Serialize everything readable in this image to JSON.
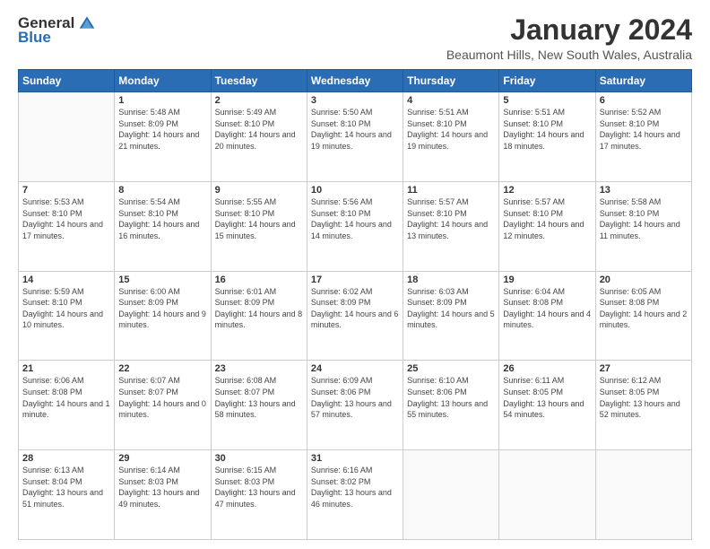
{
  "logo": {
    "general": "General",
    "blue": "Blue"
  },
  "title": "January 2024",
  "location": "Beaumont Hills, New South Wales, Australia",
  "days_header": [
    "Sunday",
    "Monday",
    "Tuesday",
    "Wednesday",
    "Thursday",
    "Friday",
    "Saturday"
  ],
  "weeks": [
    [
      {
        "day": "",
        "sunrise": "",
        "sunset": "",
        "daylight": ""
      },
      {
        "day": "1",
        "sunrise": "Sunrise: 5:48 AM",
        "sunset": "Sunset: 8:09 PM",
        "daylight": "Daylight: 14 hours and 21 minutes."
      },
      {
        "day": "2",
        "sunrise": "Sunrise: 5:49 AM",
        "sunset": "Sunset: 8:10 PM",
        "daylight": "Daylight: 14 hours and 20 minutes."
      },
      {
        "day": "3",
        "sunrise": "Sunrise: 5:50 AM",
        "sunset": "Sunset: 8:10 PM",
        "daylight": "Daylight: 14 hours and 19 minutes."
      },
      {
        "day": "4",
        "sunrise": "Sunrise: 5:51 AM",
        "sunset": "Sunset: 8:10 PM",
        "daylight": "Daylight: 14 hours and 19 minutes."
      },
      {
        "day": "5",
        "sunrise": "Sunrise: 5:51 AM",
        "sunset": "Sunset: 8:10 PM",
        "daylight": "Daylight: 14 hours and 18 minutes."
      },
      {
        "day": "6",
        "sunrise": "Sunrise: 5:52 AM",
        "sunset": "Sunset: 8:10 PM",
        "daylight": "Daylight: 14 hours and 17 minutes."
      }
    ],
    [
      {
        "day": "7",
        "sunrise": "Sunrise: 5:53 AM",
        "sunset": "Sunset: 8:10 PM",
        "daylight": "Daylight: 14 hours and 17 minutes."
      },
      {
        "day": "8",
        "sunrise": "Sunrise: 5:54 AM",
        "sunset": "Sunset: 8:10 PM",
        "daylight": "Daylight: 14 hours and 16 minutes."
      },
      {
        "day": "9",
        "sunrise": "Sunrise: 5:55 AM",
        "sunset": "Sunset: 8:10 PM",
        "daylight": "Daylight: 14 hours and 15 minutes."
      },
      {
        "day": "10",
        "sunrise": "Sunrise: 5:56 AM",
        "sunset": "Sunset: 8:10 PM",
        "daylight": "Daylight: 14 hours and 14 minutes."
      },
      {
        "day": "11",
        "sunrise": "Sunrise: 5:57 AM",
        "sunset": "Sunset: 8:10 PM",
        "daylight": "Daylight: 14 hours and 13 minutes."
      },
      {
        "day": "12",
        "sunrise": "Sunrise: 5:57 AM",
        "sunset": "Sunset: 8:10 PM",
        "daylight": "Daylight: 14 hours and 12 minutes."
      },
      {
        "day": "13",
        "sunrise": "Sunrise: 5:58 AM",
        "sunset": "Sunset: 8:10 PM",
        "daylight": "Daylight: 14 hours and 11 minutes."
      }
    ],
    [
      {
        "day": "14",
        "sunrise": "Sunrise: 5:59 AM",
        "sunset": "Sunset: 8:10 PM",
        "daylight": "Daylight: 14 hours and 10 minutes."
      },
      {
        "day": "15",
        "sunrise": "Sunrise: 6:00 AM",
        "sunset": "Sunset: 8:09 PM",
        "daylight": "Daylight: 14 hours and 9 minutes."
      },
      {
        "day": "16",
        "sunrise": "Sunrise: 6:01 AM",
        "sunset": "Sunset: 8:09 PM",
        "daylight": "Daylight: 14 hours and 8 minutes."
      },
      {
        "day": "17",
        "sunrise": "Sunrise: 6:02 AM",
        "sunset": "Sunset: 8:09 PM",
        "daylight": "Daylight: 14 hours and 6 minutes."
      },
      {
        "day": "18",
        "sunrise": "Sunrise: 6:03 AM",
        "sunset": "Sunset: 8:09 PM",
        "daylight": "Daylight: 14 hours and 5 minutes."
      },
      {
        "day": "19",
        "sunrise": "Sunrise: 6:04 AM",
        "sunset": "Sunset: 8:08 PM",
        "daylight": "Daylight: 14 hours and 4 minutes."
      },
      {
        "day": "20",
        "sunrise": "Sunrise: 6:05 AM",
        "sunset": "Sunset: 8:08 PM",
        "daylight": "Daylight: 14 hours and 2 minutes."
      }
    ],
    [
      {
        "day": "21",
        "sunrise": "Sunrise: 6:06 AM",
        "sunset": "Sunset: 8:08 PM",
        "daylight": "Daylight: 14 hours and 1 minute."
      },
      {
        "day": "22",
        "sunrise": "Sunrise: 6:07 AM",
        "sunset": "Sunset: 8:07 PM",
        "daylight": "Daylight: 14 hours and 0 minutes."
      },
      {
        "day": "23",
        "sunrise": "Sunrise: 6:08 AM",
        "sunset": "Sunset: 8:07 PM",
        "daylight": "Daylight: 13 hours and 58 minutes."
      },
      {
        "day": "24",
        "sunrise": "Sunrise: 6:09 AM",
        "sunset": "Sunset: 8:06 PM",
        "daylight": "Daylight: 13 hours and 57 minutes."
      },
      {
        "day": "25",
        "sunrise": "Sunrise: 6:10 AM",
        "sunset": "Sunset: 8:06 PM",
        "daylight": "Daylight: 13 hours and 55 minutes."
      },
      {
        "day": "26",
        "sunrise": "Sunrise: 6:11 AM",
        "sunset": "Sunset: 8:05 PM",
        "daylight": "Daylight: 13 hours and 54 minutes."
      },
      {
        "day": "27",
        "sunrise": "Sunrise: 6:12 AM",
        "sunset": "Sunset: 8:05 PM",
        "daylight": "Daylight: 13 hours and 52 minutes."
      }
    ],
    [
      {
        "day": "28",
        "sunrise": "Sunrise: 6:13 AM",
        "sunset": "Sunset: 8:04 PM",
        "daylight": "Daylight: 13 hours and 51 minutes."
      },
      {
        "day": "29",
        "sunrise": "Sunrise: 6:14 AM",
        "sunset": "Sunset: 8:03 PM",
        "daylight": "Daylight: 13 hours and 49 minutes."
      },
      {
        "day": "30",
        "sunrise": "Sunrise: 6:15 AM",
        "sunset": "Sunset: 8:03 PM",
        "daylight": "Daylight: 13 hours and 47 minutes."
      },
      {
        "day": "31",
        "sunrise": "Sunrise: 6:16 AM",
        "sunset": "Sunset: 8:02 PM",
        "daylight": "Daylight: 13 hours and 46 minutes."
      },
      {
        "day": "",
        "sunrise": "",
        "sunset": "",
        "daylight": ""
      },
      {
        "day": "",
        "sunrise": "",
        "sunset": "",
        "daylight": ""
      },
      {
        "day": "",
        "sunrise": "",
        "sunset": "",
        "daylight": ""
      }
    ]
  ]
}
